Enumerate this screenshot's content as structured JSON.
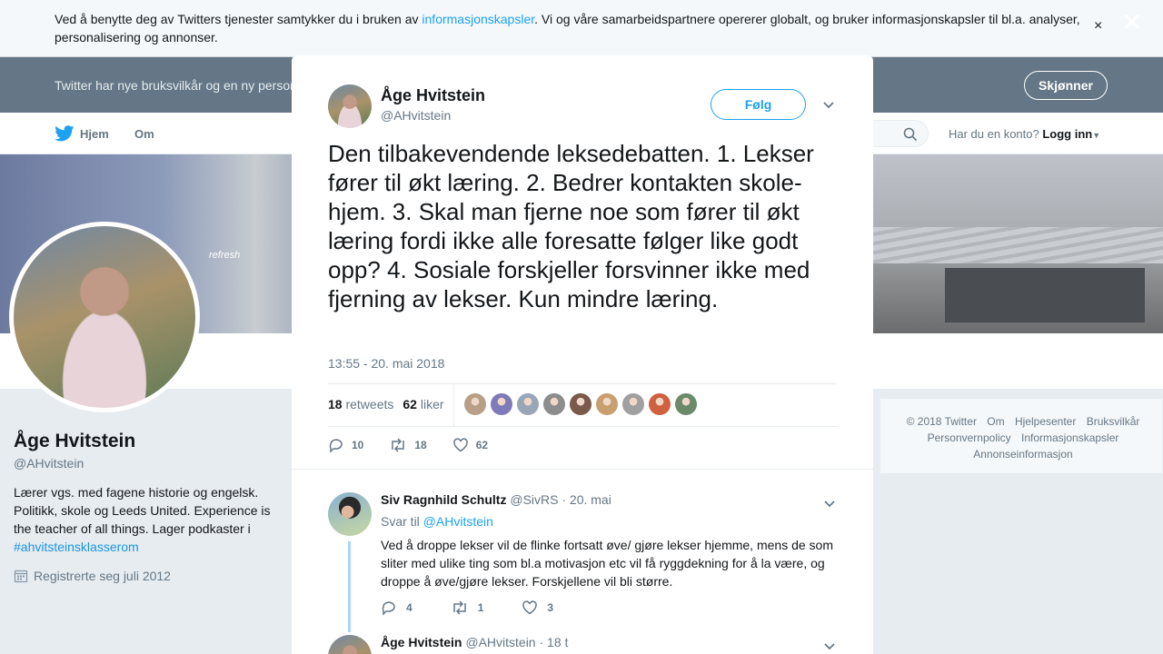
{
  "cookie": {
    "text_before": "Ved å benytte deg av Twitters tjenester samtykker du i bruken av ",
    "link": "informasjonskapsler",
    "text_after": ". Vi og våre samarbeidspartnere opererer globalt, og bruker informasjonskapsler til bl.a. analyser, personalisering og annonser.",
    "close": "×"
  },
  "terms": {
    "text": "Twitter har nye bruksvilkår og en ny personv",
    "button": "Skjønner"
  },
  "nav": {
    "home": "Hjem",
    "about": "Om",
    "account_q": "Har du en konto?",
    "login": "Logg inn"
  },
  "banner": {
    "sign": "refresh"
  },
  "profile": {
    "name": "Åge Hvitstein",
    "handle": "@AHvitstein",
    "bio": "Lærer vgs. med fagene historie og engelsk. Politikk, skole og Leeds United. Experience is the teacher of all things. Lager podkaster i ",
    "bio_tag": "#ahvitsteinsklasserom",
    "joined": "Registrerte seg juli 2012"
  },
  "footer": {
    "links": [
      "© 2018 Twitter",
      "Om",
      "Hjelpesenter",
      "Bruksvilkår",
      "Personvernpolicy",
      "Informasjonskapsler",
      "Annonseinformasjon"
    ]
  },
  "overlay": {
    "close": "✕"
  },
  "tweet": {
    "name": "Åge Hvitstein",
    "handle": "@AHvitstein",
    "follow": "Følg",
    "text": "Den tilbakevendende leksedebatten. 1. Lekser fører til økt læring. 2. Bedrer kontakten skole-hjem. 3. Skal man fjerne noe som fører til økt læring fordi ikke alle foresatte følger like godt opp? 4. Sosiale forskjeller forsvinner ikke med fjerning av lekser. Kun mindre læring.",
    "time": "13:55 - 20. mai 2018",
    "retweets_count": "18",
    "retweets_label": "retweets",
    "likes_count": "62",
    "likes_label": "liker",
    "actions": {
      "replies": "10",
      "retweets": "18",
      "likes": "62"
    },
    "liker_colors": [
      "#b8a088",
      "#7f7ab8",
      "#9aa6b8",
      "#8d8d8d",
      "#7a5a4a",
      "#c8a070",
      "#a0a0a0",
      "#d06040",
      "#6a8a6a"
    ]
  },
  "replies": [
    {
      "name": "Siv Ragnhild Schultz",
      "handle": "@SivRS",
      "date": "· 20. mai",
      "reply_to_label": "Svar til ",
      "reply_to": "@AHvitstein",
      "text": "Ved å droppe lekser vil de flinke fortsatt øve/ gjøre lekser hjemme, mens de som sliter med ulike ting som bl.a motivasjon etc vil få ryggdekning for å la være, og droppe å øve/gjøre lekser. Forskjellene vil bli større.",
      "replies": "4",
      "retweets": "1",
      "likes": "3"
    },
    {
      "name": "Åge Hvitstein",
      "handle": "@AHvitstein",
      "date": "· 18 t"
    }
  ]
}
